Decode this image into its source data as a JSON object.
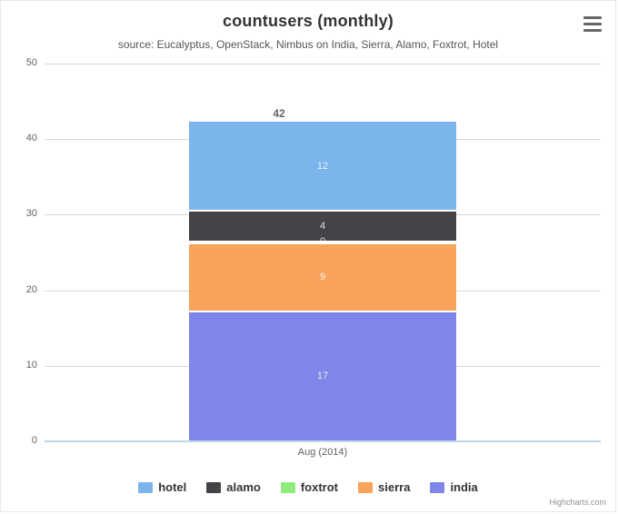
{
  "chart_data": {
    "type": "bar",
    "stacked": true,
    "title": "countusers (monthly)",
    "subtitle": "source: Eucalyptus, OpenStack, Nimbus on India, Sierra, Alamo, Foxtrot, Hotel",
    "xlabel": "",
    "ylabel": "",
    "categories": [
      "Aug (2014)"
    ],
    "ylim": [
      0,
      50
    ],
    "yticks": [
      0,
      10,
      20,
      30,
      40,
      50
    ],
    "grid": true,
    "legend_position": "bottom",
    "stack_totals": [
      42
    ],
    "series": [
      {
        "name": "hotel",
        "values": [
          12
        ],
        "color": "#7cb5ec"
      },
      {
        "name": "alamo",
        "values": [
          4
        ],
        "color": "#434348"
      },
      {
        "name": "foxtrot",
        "values": [
          0
        ],
        "color": "#90ed7d"
      },
      {
        "name": "sierra",
        "values": [
          9
        ],
        "color": "#f7a35c"
      },
      {
        "name": "india",
        "values": [
          17
        ],
        "color": "#8085e9"
      }
    ],
    "stack_order_top_to_bottom": [
      "hotel",
      "alamo",
      "foxtrot",
      "sierra",
      "india"
    ]
  },
  "toolbar": {
    "context_menu_label": "hamburger-menu"
  },
  "credits": {
    "text": "Highcharts.com"
  }
}
